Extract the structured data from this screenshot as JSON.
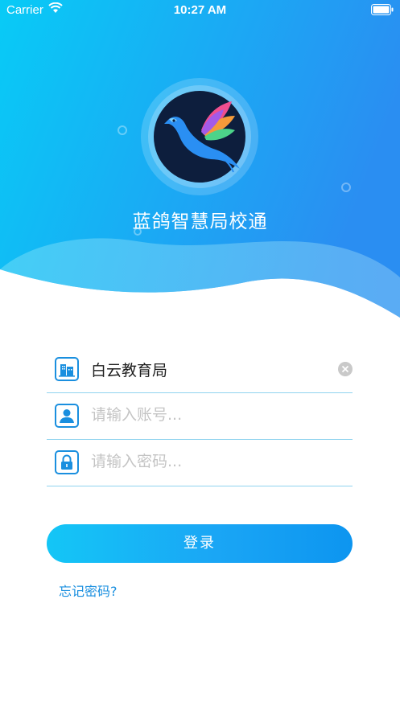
{
  "status_bar": {
    "carrier": "Carrier",
    "time": "10:27 AM"
  },
  "header": {
    "app_title": "蓝鸽智慧局校通",
    "logo": "blue-dove-logo"
  },
  "form": {
    "organization": {
      "value": "白云教育局",
      "icon": "building-icon"
    },
    "account": {
      "placeholder": "请输入账号...",
      "icon": "user-icon"
    },
    "password": {
      "placeholder": "请输入密码...",
      "icon": "lock-icon"
    },
    "login_label": "登录",
    "forgot_label": "忘记密码?"
  },
  "colors": {
    "gradient_start": "#08c7f5",
    "gradient_end": "#2a8ff3",
    "accent": "#1aa6f5",
    "link": "#1a8fdf"
  }
}
